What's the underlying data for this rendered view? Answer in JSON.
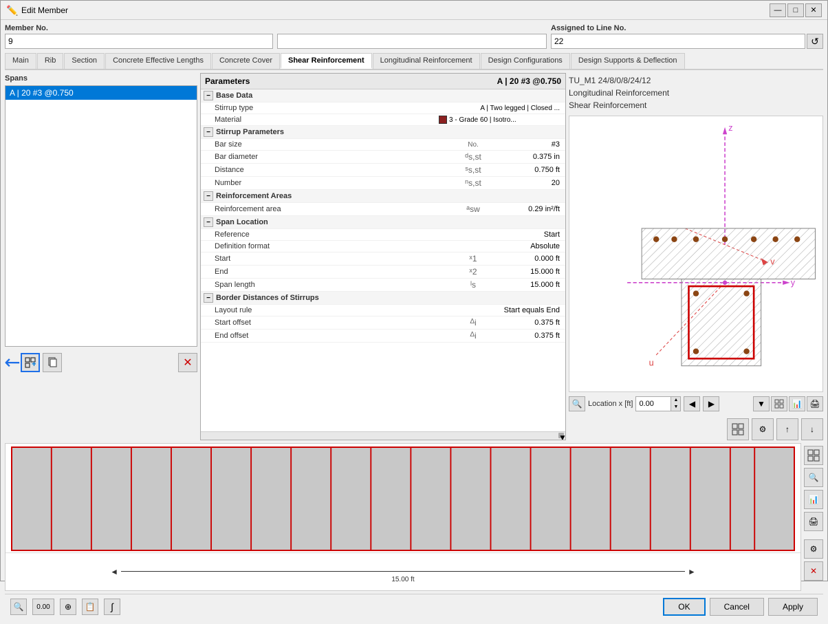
{
  "window": {
    "title": "Edit Member",
    "icon": "✏️"
  },
  "top": {
    "member_no_label": "Member No.",
    "member_no_value": "9",
    "assigned_label": "Assigned to Line No.",
    "assigned_value": "22"
  },
  "tabs": [
    {
      "id": "main",
      "label": "Main"
    },
    {
      "id": "rib",
      "label": "Rib"
    },
    {
      "id": "section",
      "label": "Section"
    },
    {
      "id": "concrete_eff",
      "label": "Concrete Effective Lengths"
    },
    {
      "id": "concrete_cover",
      "label": "Concrete Cover"
    },
    {
      "id": "shear_reinf",
      "label": "Shear Reinforcement",
      "active": true
    },
    {
      "id": "long_reinf",
      "label": "Longitudinal Reinforcement"
    },
    {
      "id": "design_config",
      "label": "Design Configurations"
    },
    {
      "id": "design_supports",
      "label": "Design Supports & Deflection"
    }
  ],
  "spans": {
    "label": "Spans",
    "items": [
      {
        "id": 1,
        "label": "A | 20 #3 @0.750",
        "selected": true
      }
    ]
  },
  "parameters": {
    "header_left": "Parameters",
    "header_right": "A | 20 #3 @0.750",
    "sections": [
      {
        "id": "base_data",
        "label": "Base Data",
        "expanded": true,
        "rows": [
          {
            "label": "Stirrup type",
            "symbol": "",
            "value": "A | Two legged | Closed ..."
          },
          {
            "label": "Material",
            "symbol": "",
            "value": "3 - Grade 60 | Isotro...",
            "has_color": true
          }
        ]
      },
      {
        "id": "stirrup_params",
        "label": "Stirrup Parameters",
        "expanded": true,
        "rows": [
          {
            "label": "Bar size",
            "symbol": "No.",
            "value": "#3"
          },
          {
            "label": "Bar diameter",
            "symbol": "ds,st",
            "value": "0.375 in"
          },
          {
            "label": "Distance",
            "symbol": "ss,st",
            "value": "0.750 ft"
          },
          {
            "label": "Number",
            "symbol": "ns,st",
            "value": "20"
          }
        ]
      },
      {
        "id": "reinf_areas",
        "label": "Reinforcement Areas",
        "expanded": true,
        "rows": [
          {
            "label": "Reinforcement area",
            "symbol": "asw",
            "value": "0.29 in²/ft"
          }
        ]
      },
      {
        "id": "span_location",
        "label": "Span Location",
        "expanded": true,
        "rows": [
          {
            "label": "Reference",
            "symbol": "",
            "value": "Start"
          },
          {
            "label": "Definition format",
            "symbol": "",
            "value": "Absolute"
          },
          {
            "label": "Start",
            "symbol": "x1",
            "value": "0.000 ft"
          },
          {
            "label": "End",
            "symbol": "x2",
            "value": "15.000 ft"
          },
          {
            "label": "Span length",
            "symbol": "ls",
            "value": "15.000 ft"
          }
        ]
      },
      {
        "id": "border_distances",
        "label": "Border Distances of Stirrups",
        "expanded": true,
        "rows": [
          {
            "label": "Layout rule",
            "symbol": "",
            "value": "Start equals End"
          },
          {
            "label": "Start offset",
            "symbol": "Δi",
            "value": "0.375 ft"
          },
          {
            "label": "End offset",
            "symbol": "Δi",
            "value": "0.375 ft"
          }
        ]
      }
    ]
  },
  "cross_section": {
    "info_line1": "TU_M1 24/8/0/8/24/12",
    "info_line2": "Longitudinal Reinforcement",
    "info_line3": "Shear Reinforcement",
    "location_label": "Location x [ft]",
    "location_value": "0.00"
  },
  "beam": {
    "dimension_label": "15.00 ft"
  },
  "buttons": {
    "ok": "OK",
    "cancel": "Cancel",
    "apply": "Apply"
  },
  "toolbar": {
    "icons": [
      "🔍",
      "0.00",
      "⊕",
      "📋",
      "∫"
    ]
  }
}
